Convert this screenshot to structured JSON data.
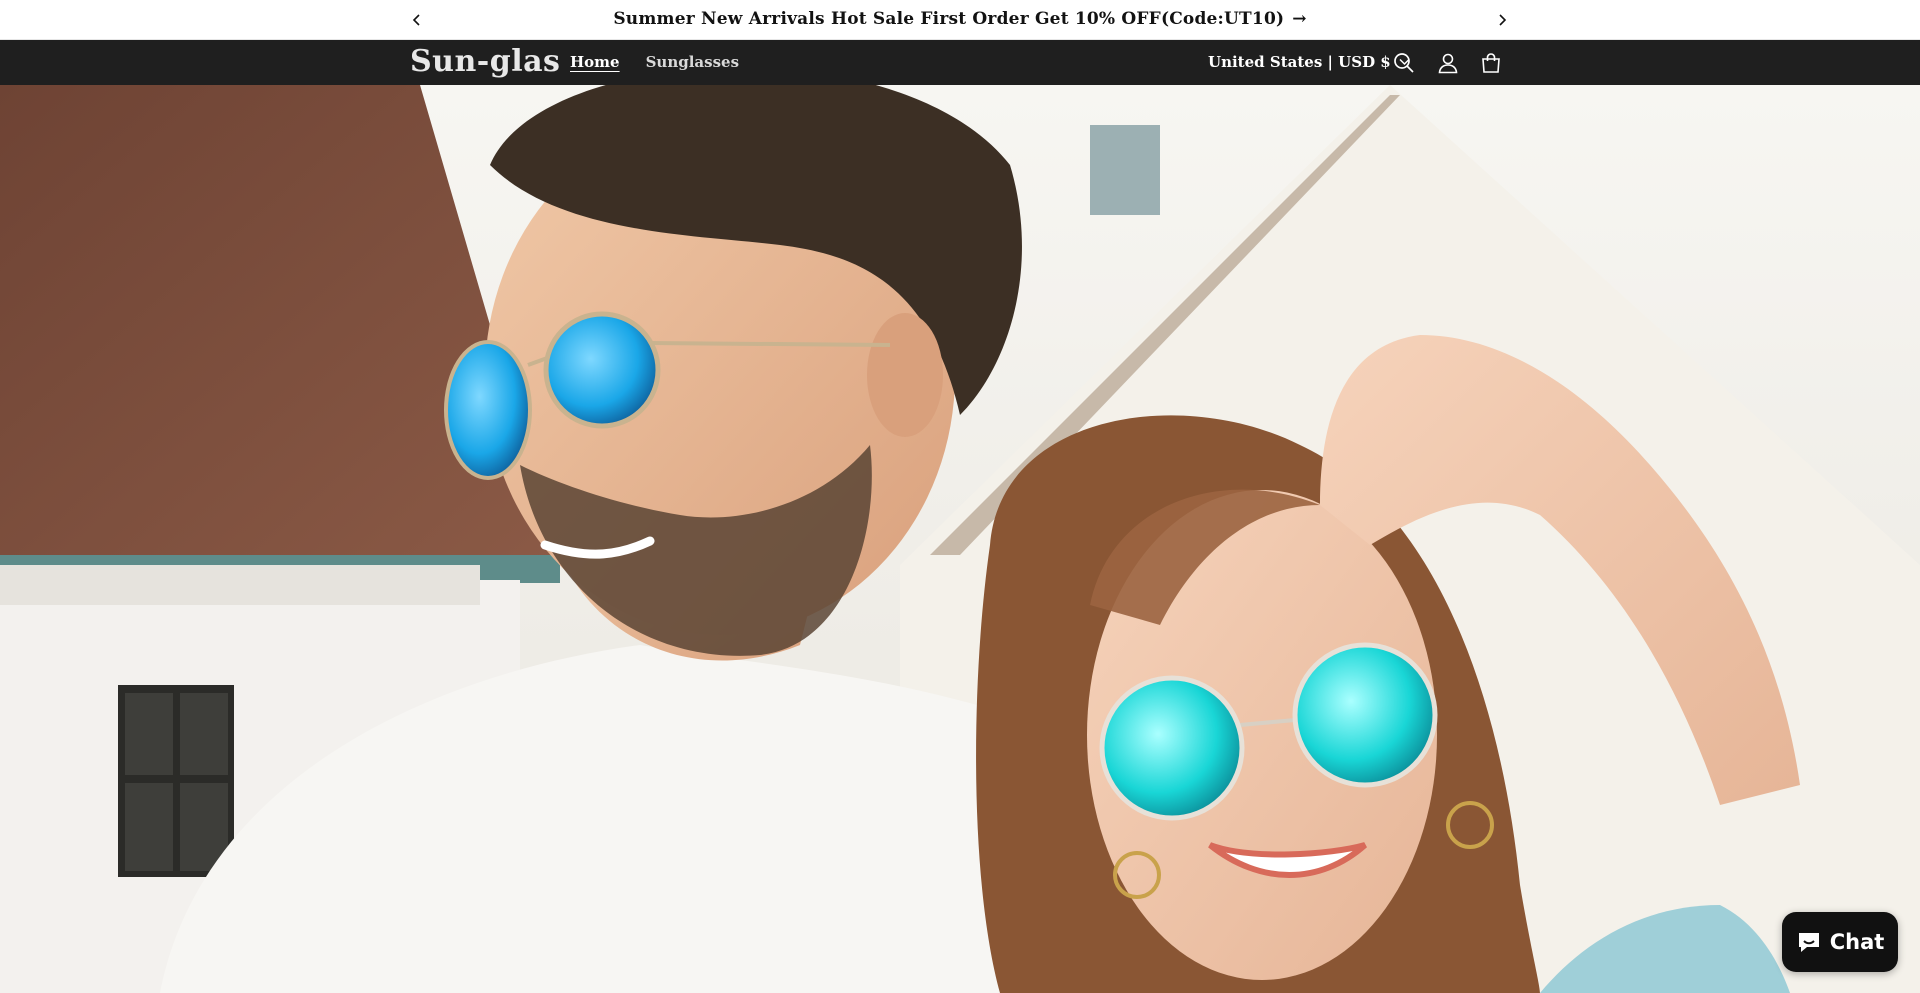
{
  "announcement": {
    "message": "Summer New Arrivals Hot Sale First Order Get 10% OFF(Code:UT10)",
    "arrow": "→"
  },
  "header": {
    "logo": "Sun-glas",
    "nav": [
      {
        "label": "Home",
        "active": true
      },
      {
        "label": "Sunglasses",
        "active": false
      }
    ],
    "locale": "United States | USD $",
    "icons": [
      "search-icon",
      "account-icon",
      "cart-icon"
    ]
  },
  "hero": {
    "image_alt_icon": "hero-photo"
  },
  "chat": {
    "label": "Chat"
  },
  "colors": {
    "header_bg": "#1f1f1f",
    "announce_bg": "#ffffff",
    "chat_bg": "#111111",
    "lens_blue": "#1aa7e8",
    "lens_cyan": "#19d6d6"
  }
}
